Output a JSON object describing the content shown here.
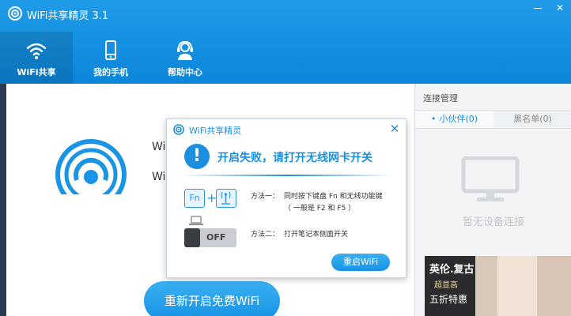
{
  "app": {
    "title": "WiFi共享精灵 3.1"
  },
  "window_controls": {
    "minimize": "—",
    "close": "✕"
  },
  "nav": [
    {
      "label": "WiFi共享",
      "icon": "wifi-icon",
      "active": true
    },
    {
      "label": "我的手机",
      "icon": "phone-icon",
      "active": false
    },
    {
      "label": "帮助中心",
      "icon": "headset-icon",
      "active": false
    }
  ],
  "main": {
    "ssid_line1": "Wi",
    "ssid_line2": "Wi",
    "restart_button": "重新开启免费WiFi"
  },
  "dialog": {
    "title": "WiFi共享精灵",
    "close": "✕",
    "alert_symbol": "!",
    "alert": "开启失败，请打开无线网卡开关",
    "fn_key": "Fn",
    "plus": "+",
    "method1_label": "方法一：",
    "method1_line1": "同时按下键盘 Fn 和无线功能键",
    "method1_line2": "（ 一般是 F2 和 F5 ）",
    "toggle_label": "OFF",
    "method2_label": "方法二：",
    "method2_text": "打开笔记本侧面开关",
    "restart_button": "重启WiFi"
  },
  "connections": {
    "title": "连接管理",
    "tabs": [
      {
        "label": "小伙伴(0)",
        "active": true
      },
      {
        "label": "黑名单(0)",
        "active": false
      }
    ],
    "empty_text": "暂无设备连接"
  },
  "ad": {
    "line1": "英伦.复古",
    "line2": "超显高",
    "line3": "五折特惠"
  },
  "colors": {
    "accent": "#1d8fe0",
    "header": "#1591e0"
  }
}
